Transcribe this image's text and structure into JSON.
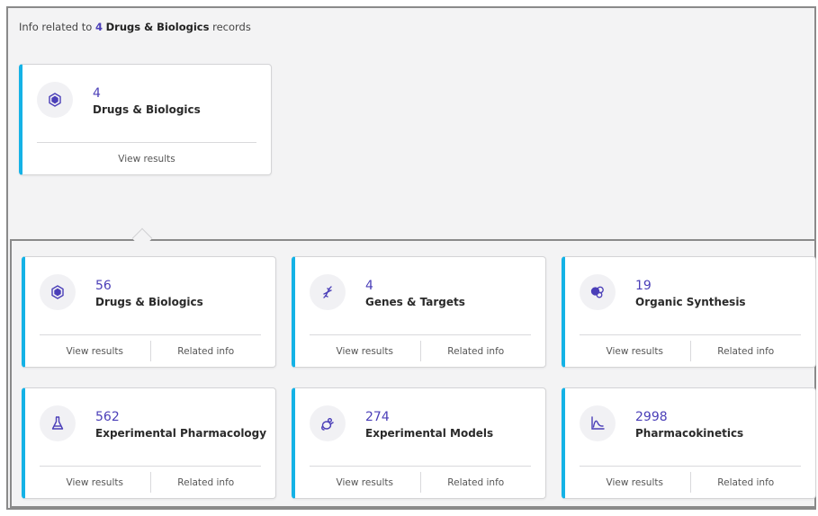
{
  "header": {
    "prefix": "Info related to",
    "count": "4",
    "category": "Drugs & Biologics",
    "suffix": "records"
  },
  "source_card": {
    "icon": "drug-molecule-icon",
    "count": "4",
    "label": "Drugs & Biologics",
    "view_label": "View results"
  },
  "related_cards": [
    {
      "icon": "drug-molecule-icon",
      "count": "56",
      "label": "Drugs & Biologics",
      "view_label": "View results",
      "related_label": "Related info"
    },
    {
      "icon": "dna-helix-icon",
      "count": "4",
      "label": "Genes & Targets",
      "view_label": "View results",
      "related_label": "Related info"
    },
    {
      "icon": "synthesis-molecules-icon",
      "count": "19",
      "label": "Organic Synthesis",
      "view_label": "View results",
      "related_label": "Related info"
    },
    {
      "icon": "flask-icon",
      "count": "562",
      "label": "Experimental Pharmacology",
      "view_label": "View results",
      "related_label": "Related info"
    },
    {
      "icon": "mouse-model-icon",
      "count": "274",
      "label": "Experimental Models",
      "view_label": "View results",
      "related_label": "Related info"
    },
    {
      "icon": "pk-curve-icon",
      "count": "2998",
      "label": "Pharmacokinetics",
      "view_label": "View results",
      "related_label": "Related info"
    }
  ],
  "colors": {
    "accent": "#14b2e6",
    "count_text": "#4b3fb8",
    "icon_stroke": "#4b3fb8"
  }
}
